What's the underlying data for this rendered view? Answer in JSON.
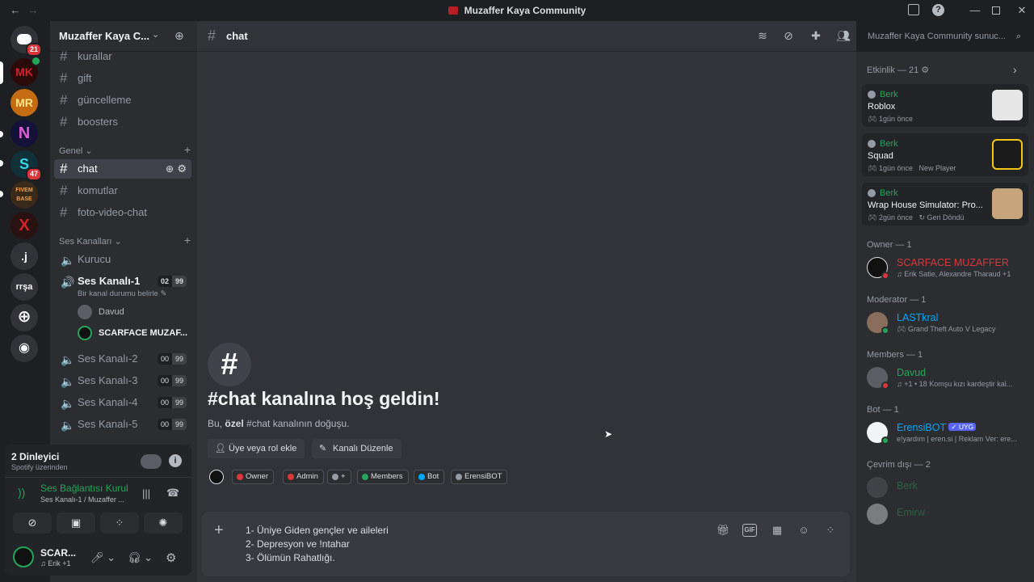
{
  "window": {
    "title": "Muzaffer Kaya Community"
  },
  "servers": [
    {
      "name": "Direct Messages",
      "badge": "21"
    },
    {
      "name": "MK",
      "badge": ""
    },
    {
      "name": "MR",
      "badge": ""
    },
    {
      "name": "N",
      "badge": ""
    },
    {
      "name": "S",
      "badge": "47"
    },
    {
      "name": "FIVEM BASE",
      "badge": ""
    },
    {
      "name": "X",
      "badge": ""
    },
    {
      "name": ".j",
      "badge": ""
    },
    {
      "name": "rrşa",
      "badge": ""
    }
  ],
  "guild": {
    "name": "Muzaffer Kaya C..."
  },
  "channels_top": [
    "kurallar",
    "gift",
    "güncelleme",
    "boosters"
  ],
  "category_general": "Genel",
  "channels_general": [
    "chat",
    "komutlar",
    "foto-video-chat"
  ],
  "category_voice": "Ses Kanalları",
  "voice_channels": [
    {
      "name": "Kurucu"
    },
    {
      "name": "Ses Kanalı-1",
      "users": "02",
      "limit": "99",
      "status": "Bir kanal durumu belirle"
    },
    {
      "name": "Ses Kanalı-2",
      "users": "00",
      "limit": "99"
    },
    {
      "name": "Ses Kanalı-3",
      "users": "00",
      "limit": "99"
    },
    {
      "name": "Ses Kanalı-4",
      "users": "00",
      "limit": "99"
    },
    {
      "name": "Ses Kanalı-5",
      "users": "00",
      "limit": "99"
    }
  ],
  "voice_users": [
    "Davud",
    "SCARFACE MUZAF..."
  ],
  "voice_panel": {
    "listeners": "2 Dinleyici",
    "listeners_sub": "Spotify üzerinden",
    "connection": "Ses Bağlantısı Kurul",
    "connection_sub": "Ses Kanalı-1 / Muzaffer ...",
    "user_name": "SCAR...",
    "user_status": "Erik",
    "user_status_extra": "+1"
  },
  "main": {
    "channel": "chat",
    "search_placeholder": "Muzaffer Kaya Community sunuc...",
    "welcome_title": "#chat kanalına hoş geldin!",
    "welcome_pre": "Bu, ",
    "welcome_bold": "özel",
    "welcome_post": " #chat kanalının doğuşu.",
    "add_members_button": "Üye veya rol ekle",
    "edit_channel_button": "Kanalı Düzenle",
    "roles": [
      {
        "name": "Owner",
        "color": "#da373c"
      },
      {
        "name": "Admin",
        "color": "#da373c"
      },
      {
        "name": "+",
        "color": "#949ba4"
      },
      {
        "name": "Members",
        "color": "#23a55a"
      },
      {
        "name": "Bot",
        "color": "#00a8fc"
      },
      {
        "name": "ErensiBOT",
        "color": "#949ba4"
      }
    ],
    "composer_lines": [
      "1- Üniye Giden gençler ve aileleri",
      "2- Depresyon ve !ntahar",
      "3- Ölümün Rahatlığı."
    ]
  },
  "members": {
    "activity_header": "Etkinlik — 21",
    "activities": [
      {
        "user": "Berk",
        "game": "Roblox",
        "time": "1gün önce",
        "extra": ""
      },
      {
        "user": "Berk",
        "game": "Squad",
        "time": "1gün önce",
        "extra": "New Player"
      },
      {
        "user": "Berk",
        "game": "Wrap House Simulator: Pro...",
        "time": "2gün önce",
        "extra": "Geri Döndü"
      }
    ],
    "sections": [
      {
        "title": "Owner — 1",
        "members": [
          {
            "name": "SCARFACE MUZAFFER",
            "desc": "Erik Satie, Alexandre Tharaud +1",
            "color": "#da373c",
            "status": "#da373c"
          }
        ]
      },
      {
        "title": "Moderator — 1",
        "members": [
          {
            "name": "LASTkral",
            "desc": "Grand Theft Auto V Legacy",
            "color": "#00a8fc",
            "status": "#23a55a"
          }
        ]
      },
      {
        "title": "Members — 1",
        "members": [
          {
            "name": "Davud",
            "desc": "+1 • 18 Komşu kızı kardeştir kal...",
            "color": "#23a55a",
            "status": "#da373c"
          }
        ]
      },
      {
        "title": "Bot — 1",
        "members": [
          {
            "name": "ErensiBOT",
            "tag": "UYG",
            "desc": "e!yardım | eren.si | Reklam Ver: ere...",
            "color": "#00a8fc",
            "status": "#23a55a"
          }
        ]
      },
      {
        "title": "Çevrim dışı — 2",
        "members": [
          {
            "name": "Berk",
            "desc": "",
            "color": "#3d6b4e",
            "status": ""
          },
          {
            "name": "Emirw",
            "desc": "",
            "color": "#3d6b4e",
            "status": ""
          }
        ]
      }
    ]
  }
}
